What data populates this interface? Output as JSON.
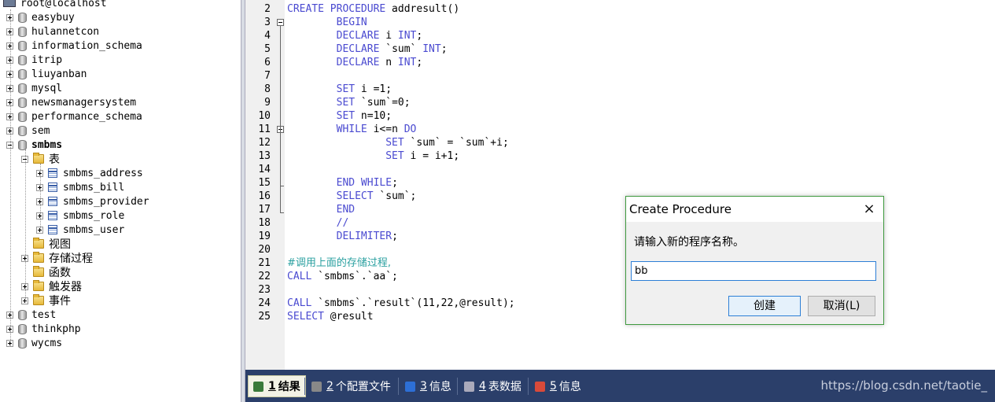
{
  "tree": {
    "root_label": "root@localhost",
    "databases": [
      "easybuy",
      "hulannetcon",
      "information_schema",
      "itrip",
      "liuyanban",
      "mysql",
      "newsmanagersystem",
      "performance_schema",
      "sem",
      "smbms"
    ],
    "smbms_children": {
      "tables_folder": "表",
      "tables": [
        "smbms_address",
        "smbms_bill",
        "smbms_provider",
        "smbms_role",
        "smbms_user"
      ],
      "views_folder": "视图",
      "procedures_folder": "存储过程",
      "functions_folder": "函数",
      "triggers_folder": "触发器",
      "events_folder": "事件"
    },
    "after_databases": [
      "test",
      "thinkphp",
      "wycms"
    ]
  },
  "editor": {
    "line_numbers": [
      "2",
      "3",
      "4",
      "5",
      "6",
      "7",
      "8",
      "9",
      "10",
      "11",
      "12",
      "13",
      "14",
      "15",
      "16",
      "17",
      "18",
      "19",
      "20",
      "21",
      "22",
      "23",
      "24",
      "25"
    ],
    "lines": [
      "CREATE PROCEDURE addresult()",
      "        BEGIN",
      "        DECLARE i INT;",
      "        DECLARE `sum` INT;",
      "        DECLARE n INT;",
      "",
      "        SET i =1;",
      "        SET `sum`=0;",
      "        SET n=10;",
      "        WHILE i<=n DO",
      "                SET `sum` = `sum`+i;",
      "                SET i = i+1;",
      "",
      "        END WHILE;",
      "        SELECT `sum`;",
      "        END",
      "        //",
      "        DELIMITER;",
      "",
      "#调用上面的存储过程,",
      "CALL `smbms`.`aa`;",
      "",
      "CALL `smbms`.`result`(11,22,@result);",
      "SELECT @result"
    ]
  },
  "tabs": [
    {
      "num": "1",
      "label": "结果",
      "active": true
    },
    {
      "num": "2",
      "label": "个配置文件",
      "active": false
    },
    {
      "num": "3",
      "label": "信息",
      "active": false
    },
    {
      "num": "4",
      "label": "表数据",
      "active": false
    },
    {
      "num": "5",
      "label": "信息",
      "active": false
    }
  ],
  "watermark": "https://blog.csdn.net/taotie_",
  "dialog": {
    "title": "Create Procedure",
    "close": "×",
    "prompt": "请输入新的程序名称。",
    "input_value": "bb",
    "create_button": "创建",
    "cancel_button": "取消(L)"
  },
  "colors": {
    "keyword": "#4a4ad0",
    "comment": "#2aa0a0",
    "tab_bar": "#2b3f6a",
    "dialog_border": "#3f9a3f",
    "focus_blue": "#2d7fd6"
  }
}
